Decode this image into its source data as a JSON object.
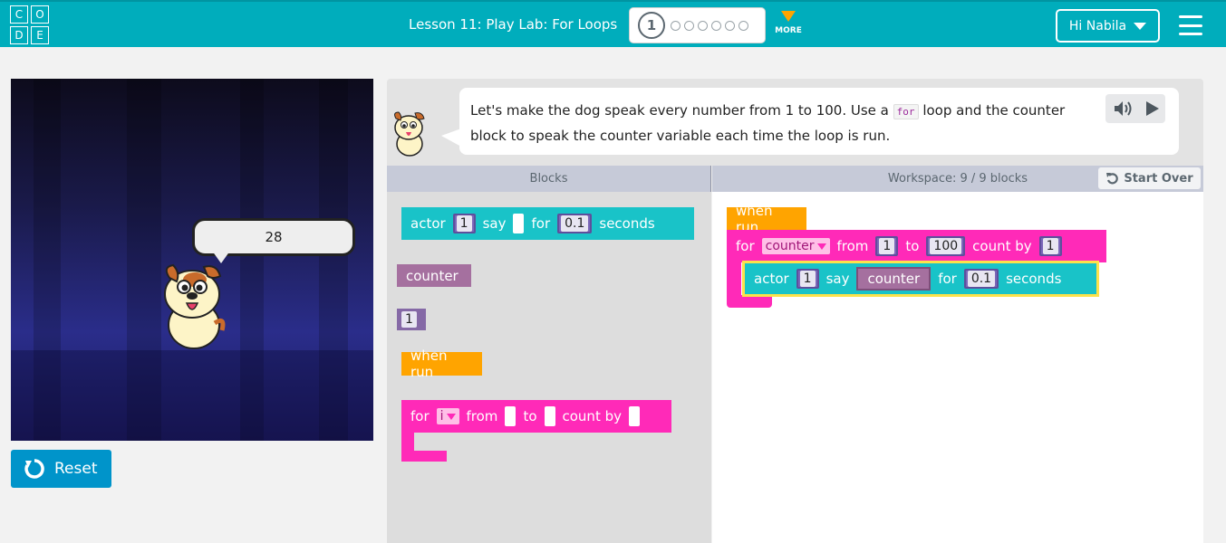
{
  "header": {
    "logo_letters": [
      "C",
      "O",
      "D",
      "E"
    ],
    "lesson_title": "Lesson 11: Play Lab: For Loops",
    "current_level": "1",
    "more_label": "MORE",
    "user_label": "Hi Nabila"
  },
  "stage": {
    "speech": "28",
    "reset_label": "Reset"
  },
  "instructions": {
    "text_before": "Let's make the dog speak every number from 1 to 100. Use a",
    "code_word": "for",
    "text_after": "loop and the counter block to speak the counter variable each time the loop is run."
  },
  "panels": {
    "blocks_label": "Blocks",
    "workspace_label": "Workspace: 9 / 9 blocks",
    "start_over_label": "Start Over"
  },
  "toolbox": {
    "actor_block": {
      "actor": "actor",
      "actor_num": "1",
      "say": "say",
      "for": "for",
      "duration": "0.1",
      "seconds": "seconds"
    },
    "counter_block": "counter",
    "number_block": "1",
    "when_run": "when run",
    "for_block": {
      "for": "for",
      "var": "i",
      "from": "from",
      "to": "to",
      "count_by": "count by"
    }
  },
  "workspace": {
    "when_run": "when run",
    "for_block": {
      "for": "for",
      "var": "counter",
      "from": "from",
      "from_val": "1",
      "to": "to",
      "to_val": "100",
      "count_by": "count by",
      "by_val": "1"
    },
    "actor_block": {
      "actor": "actor",
      "actor_num": "1",
      "say": "say",
      "say_val": "counter",
      "for": "for",
      "duration": "0.1",
      "seconds": "seconds"
    }
  }
}
